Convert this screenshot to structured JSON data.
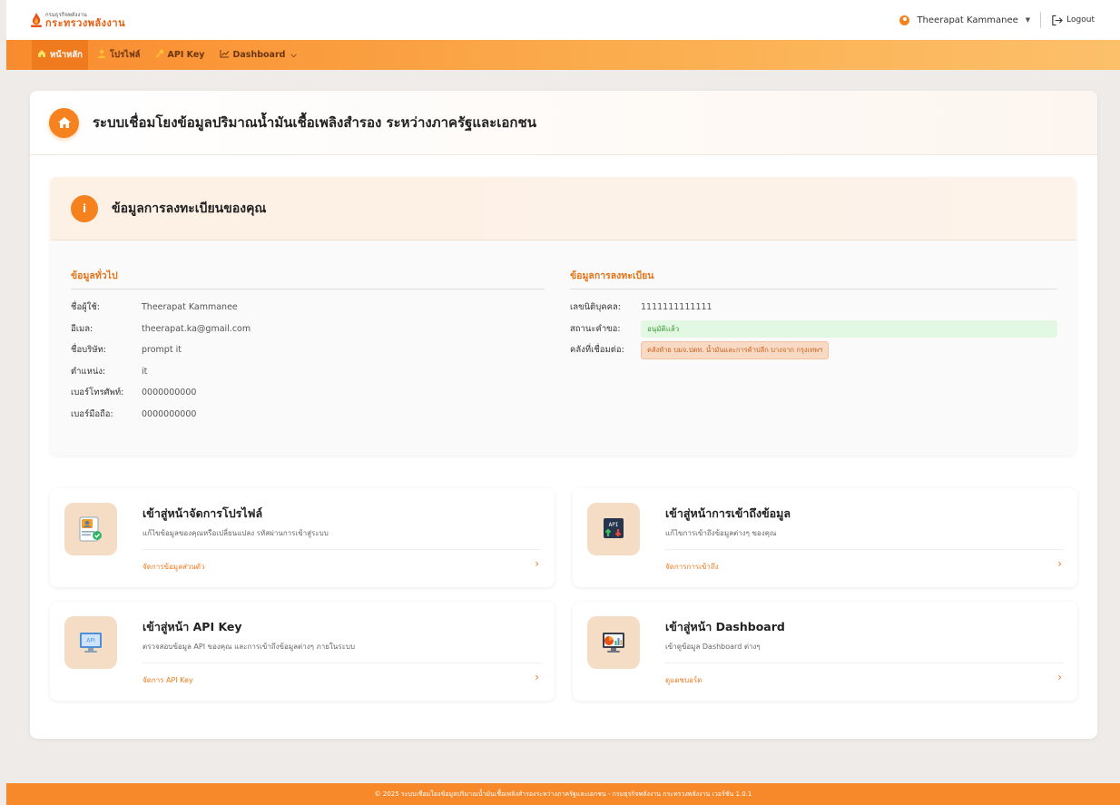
{
  "header": {
    "logo_sub": "กรมธุรกิจพลังงาน",
    "logo_main": "กระทรวงพลังงาน",
    "user_name": "Theerapat Kammanee",
    "logout_label": "Logout"
  },
  "nav": {
    "items": [
      {
        "label": "หน้าหลัก",
        "icon": "home-icon",
        "active": true
      },
      {
        "label": "โปรไฟล์",
        "icon": "user-icon",
        "active": false
      },
      {
        "label": "API Key",
        "icon": "key-icon",
        "active": false
      },
      {
        "label": "Dashboard",
        "icon": "chart-line-icon",
        "active": false
      }
    ]
  },
  "page": {
    "title": "ระบบเชื่อมโยงข้อมูลปริมาณน้ำมันเชื้อเพลิงสำรอง ระหว่างภาครัฐและเอกชน"
  },
  "registration": {
    "title": "ข้อมูลการลงทะเบียนของคุณ",
    "general": {
      "title": "ข้อมูลทั่วไป",
      "rows": [
        {
          "label": "ชื่อผู้ใช้:",
          "value": "Theerapat Kammanee"
        },
        {
          "label": "อีเมล:",
          "value": "theerapat.ka@gmail.com"
        },
        {
          "label": "ชื่อบริษัท:",
          "value": "prompt it"
        },
        {
          "label": "ตำแหน่ง:",
          "value": "it"
        },
        {
          "label": "เบอร์โทรศัพท์:",
          "value": "0000000000"
        },
        {
          "label": "เบอร์มือถือ:",
          "value": "0000000000"
        }
      ]
    },
    "detail": {
      "title": "ข้อมูลการลงทะเบียน",
      "juristic_label": "เลขนิติบุคคล:",
      "juristic_value": "1111111111111",
      "status_label": "สถานะคำขอ:",
      "status_value": "อนุมัติแล้ว",
      "depot_label": "คลังที่เชื่อมต่อ:",
      "depot_value": "คลังท้าย บมจ.ปตท. น้ำมันและการค้าปลีก บางจาก กรุงเทพฯ"
    }
  },
  "cards": [
    {
      "title": "เข้าสู่หน้าจัดการโปรไฟล์",
      "desc": "แก้ไขข้อมูลของคุณหรือเปลี่ยนแปลง รหัสผ่านการเข้าสู่ระบบ",
      "link": "จัดการข้อมูลส่วนตัว",
      "icon": "profile-card-icon"
    },
    {
      "title": "เข้าสู่หน้าการเข้าถึงข้อมูล",
      "desc": "แก้ไขการเข้าถึงข้อมูลต่างๆ ของคุณ",
      "link": "จัดการการเข้าถึง",
      "icon": "api-access-icon"
    },
    {
      "title": "เข้าสู่หน้า API Key",
      "desc": "ตรวจสอบข้อมูล API ของคุณ และการเข้าถึงข้อมูลต่างๆ ภายในระบบ",
      "link": "จัดการ API Key",
      "icon": "api-monitor-icon"
    },
    {
      "title": "เข้าสู่หน้า Dashboard",
      "desc": "เข้าดูข้อมูล Dashboard ต่างๆ",
      "link": "ดูแดชบอร์ด",
      "icon": "dashboard-monitor-icon"
    }
  ],
  "footer": {
    "text": "© 2025 ระบบเชื่อมโยงข้อมูลปริมาณน้ำมันเชื้อเพลิงสำรองระหว่างภาครัฐและเอกชน - กรมธุรกิจพลังงาน กระทรวงพลังงาน เวอร์ชัน 1.0.1"
  },
  "colors": {
    "accent": "#f5821f",
    "nav_active": "#f07a1e",
    "status_green": "#e3f8e3",
    "footer": "#f7892b"
  }
}
